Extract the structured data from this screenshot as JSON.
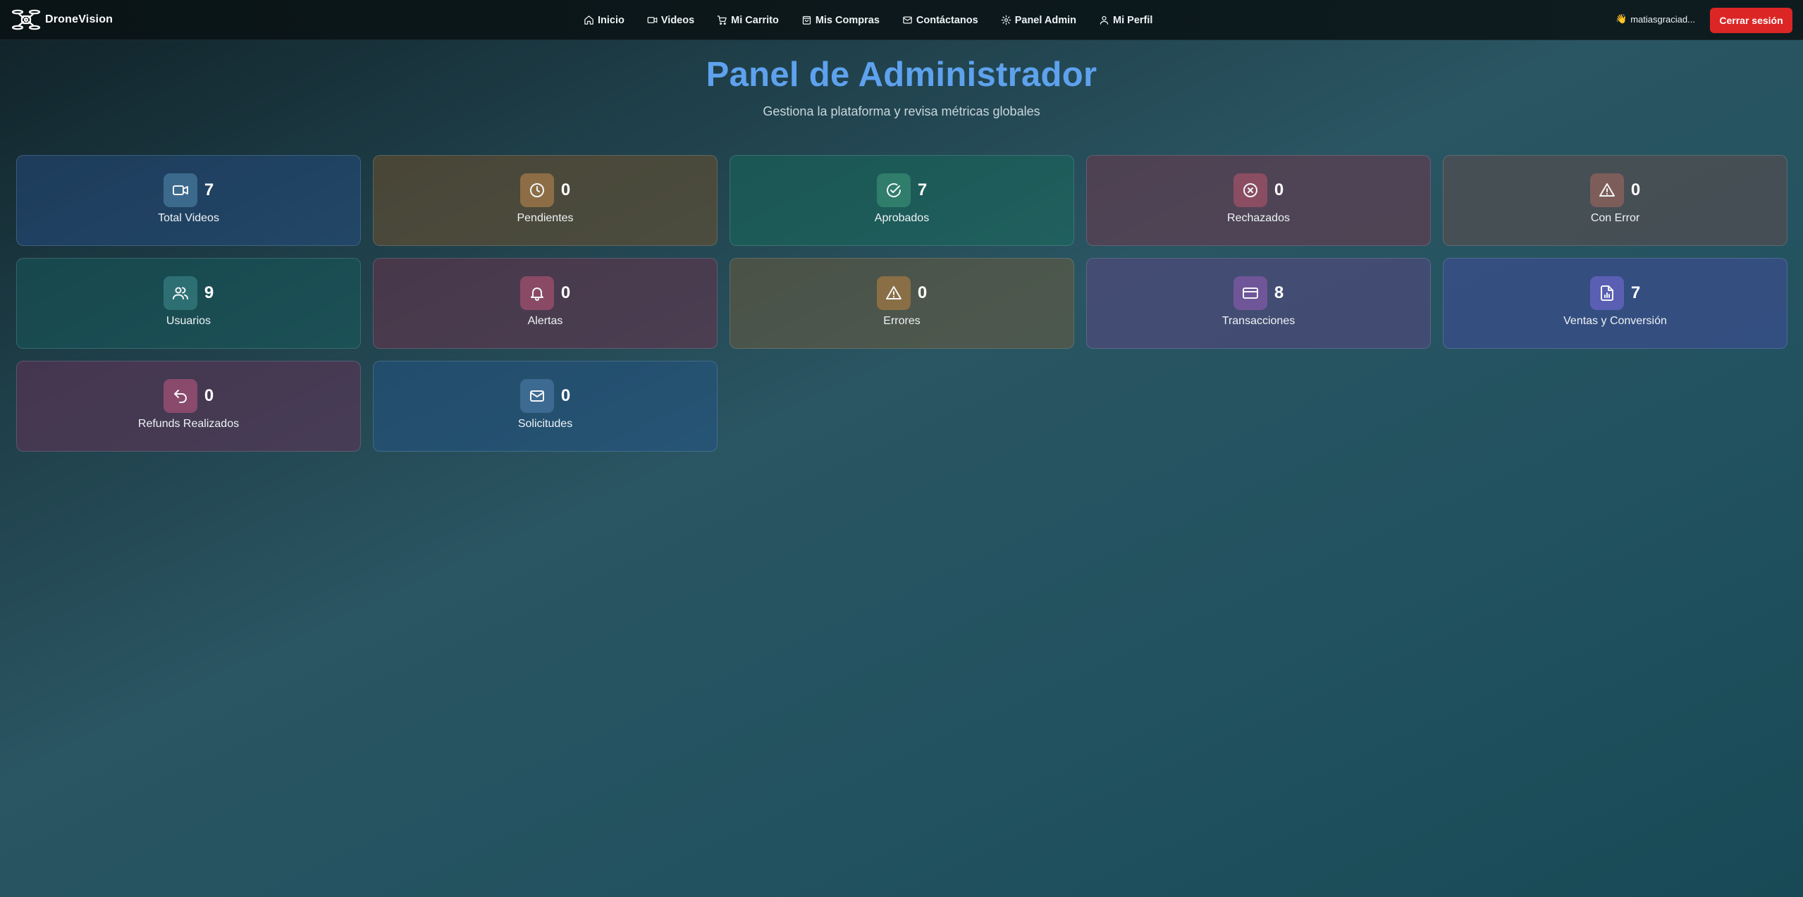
{
  "nav": {
    "brand": "DroneVision",
    "links": [
      {
        "label": "Inicio",
        "icon": "home-icon"
      },
      {
        "label": "Videos",
        "icon": "video-icon"
      },
      {
        "label": "Mi Carrito",
        "icon": "cart-icon"
      },
      {
        "label": "Mis Compras",
        "icon": "shopping-bag-icon"
      },
      {
        "label": "Contáctanos",
        "icon": "mail-icon"
      },
      {
        "label": "Panel Admin",
        "icon": "gear-icon"
      },
      {
        "label": "Mi Perfil",
        "icon": "user-icon"
      }
    ],
    "user_emoji": "👋",
    "user_name": "matiasgraciad...",
    "logout_label": "Cerrar sesión"
  },
  "header": {
    "title": "Panel de Administrador",
    "subtitle": "Gestiona la plataforma y revisa métricas globales"
  },
  "cards": [
    {
      "value": "7",
      "label": "Total Videos",
      "icon": "video-icon"
    },
    {
      "value": "0",
      "label": "Pendientes",
      "icon": "clock-icon"
    },
    {
      "value": "7",
      "label": "Aprobados",
      "icon": "check-circle-icon"
    },
    {
      "value": "0",
      "label": "Rechazados",
      "icon": "x-circle-icon"
    },
    {
      "value": "0",
      "label": "Con Error",
      "icon": "warning-icon"
    },
    {
      "value": "9",
      "label": "Usuarios",
      "icon": "users-icon"
    },
    {
      "value": "0",
      "label": "Alertas",
      "icon": "bell-icon"
    },
    {
      "value": "0",
      "label": "Errores",
      "icon": "warning-icon"
    },
    {
      "value": "8",
      "label": "Transacciones",
      "icon": "credit-card-icon"
    },
    {
      "value": "7",
      "label": "Ventas y Conversión",
      "icon": "report-chart-icon"
    },
    {
      "value": "0",
      "label": "Refunds Realizados",
      "icon": "undo-icon"
    },
    {
      "value": "0",
      "label": "Solicitudes",
      "icon": "mail-icon"
    }
  ],
  "colors": {
    "title": "#5ea2ee",
    "logout": "#dc2626"
  }
}
